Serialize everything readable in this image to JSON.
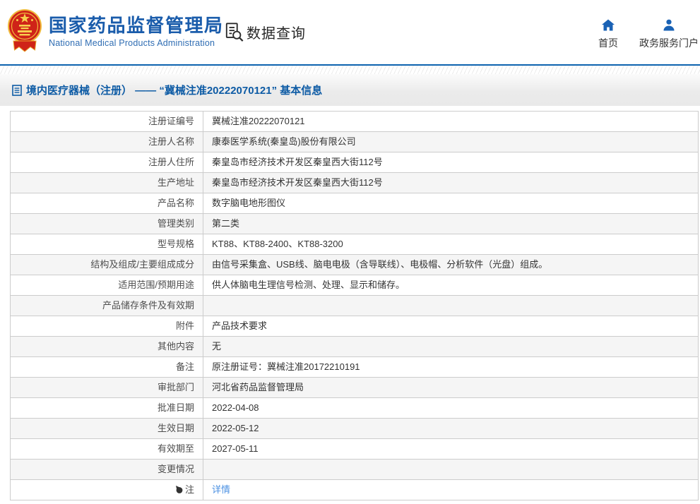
{
  "header": {
    "org_name_zh": "国家药品监督管理局",
    "org_name_en": "National Medical Products Administration",
    "data_query_label": "数据查询",
    "nav_home": "首页",
    "nav_portal": "政务服务门户"
  },
  "page": {
    "title": "境内医疗器械（注册） —— “冀械注准20222070121” 基本信息"
  },
  "colors": {
    "brand_blue": "#1a5cab",
    "divider_blue": "#0d63af",
    "title_blue": "#0d5ba5",
    "link_blue": "#4a90e2",
    "emblem_red": "#cf2318",
    "emblem_gold": "#f0b93c"
  },
  "icons": {
    "emblem": "national-emblem-logo",
    "data_query": "document-search-icon",
    "home": "home-icon",
    "portal": "user-icon",
    "title": "document-list-icon",
    "note": "note-icon"
  },
  "table": {
    "rows": [
      {
        "label": "注册证编号",
        "value": "冀械注准20222070121"
      },
      {
        "label": "注册人名称",
        "value": "康泰医学系统(秦皇岛)股份有限公司"
      },
      {
        "label": "注册人住所",
        "value": "秦皇岛市经济技术开发区秦皇西大街112号"
      },
      {
        "label": "生产地址",
        "value": "秦皇岛市经济技术开发区秦皇西大街112号"
      },
      {
        "label": "产品名称",
        "value": "数字脑电地形图仪"
      },
      {
        "label": "管理类别",
        "value": "第二类"
      },
      {
        "label": "型号规格",
        "value": "KT88、KT88-2400、KT88-3200"
      },
      {
        "label": "结构及组成/主要组成成分",
        "value": "由信号采集盒、USB线、脑电电极（含导联线）、电极帽、分析软件（光盘）组成。"
      },
      {
        "label": "适用范围/预期用途",
        "value": "供人体脑电生理信号检测、处理、显示和储存。"
      },
      {
        "label": "产品储存条件及有效期",
        "value": ""
      },
      {
        "label": "附件",
        "value": "产品技术要求"
      },
      {
        "label": "其他内容",
        "value": "无"
      },
      {
        "label": "备注",
        "value": "原注册证号：冀械注准20172210191"
      },
      {
        "label": "审批部门",
        "value": "河北省药品监督管理局"
      },
      {
        "label": "批准日期",
        "value": "2022-04-08"
      },
      {
        "label": "生效日期",
        "value": "2022-05-12"
      },
      {
        "label": "有效期至",
        "value": "2027-05-11"
      },
      {
        "label": "变更情况",
        "value": ""
      },
      {
        "label": "注",
        "value": "详情",
        "link": true,
        "icon": "note"
      }
    ]
  }
}
